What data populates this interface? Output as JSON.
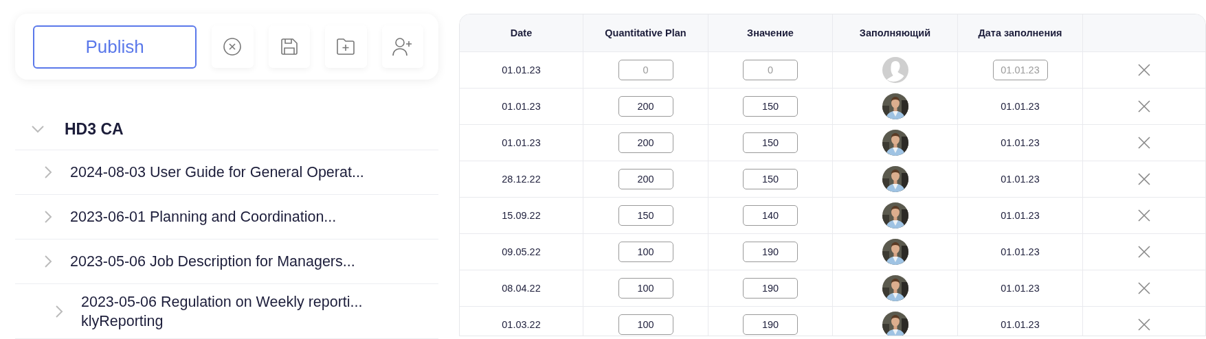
{
  "toolbar": {
    "publish": "Publish",
    "actions": [
      {
        "kind": "cancel"
      },
      {
        "kind": "save"
      },
      {
        "kind": "new-folder"
      },
      {
        "kind": "add-user"
      }
    ]
  },
  "tree": {
    "title": "HD3 CA",
    "expanded": true,
    "children": [
      {
        "label": "2024-08-03 User Guide for General Operat...",
        "expanded": false
      },
      {
        "label": "2023-06-01 Planning and Coordination...",
        "expanded": false
      },
      {
        "label": "2023-05-06 Job Description for Managers...",
        "expanded": false
      },
      {
        "label": "2023-05-06 Regulation on Weekly reporti...",
        "sublabel": "klyReporting",
        "expanded": false
      }
    ]
  },
  "table": {
    "columns": [
      "Date",
      "Quantitative Plan",
      "Значение",
      "Заполняющий",
      "Дата заполнения"
    ],
    "rows": [
      {
        "date": "01.01.23",
        "plan": {
          "placeholder": "0"
        },
        "value": {
          "placeholder": "0"
        },
        "filler": {
          "kind": "placeholder"
        },
        "filled_on": {
          "kind": "field",
          "placeholder": "01.01.23"
        }
      },
      {
        "date": "01.01.23",
        "plan": {
          "value": "200"
        },
        "value": {
          "value": "150"
        },
        "filled_on": {
          "kind": "text",
          "text": "01.01.23"
        }
      },
      {
        "date": "01.01.23",
        "plan": {
          "value": "200"
        },
        "value": {
          "value": "150"
        },
        "filled_on": {
          "kind": "text",
          "text": "01.01.23"
        }
      },
      {
        "date": "28.12.22",
        "plan": {
          "value": "200"
        },
        "value": {
          "value": "150"
        },
        "filled_on": {
          "kind": "text",
          "text": "01.01.23"
        }
      },
      {
        "date": "15.09.22",
        "plan": {
          "value": "150"
        },
        "value": {
          "value": "140"
        },
        "filled_on": {
          "kind": "text",
          "text": "01.01.23"
        }
      },
      {
        "date": "09.05.22",
        "plan": {
          "value": "100"
        },
        "value": {
          "value": "190"
        },
        "filled_on": {
          "kind": "text",
          "text": "01.01.23"
        }
      },
      {
        "date": "08.04.22",
        "plan": {
          "value": "100"
        },
        "value": {
          "value": "190"
        },
        "filled_on": {
          "kind": "text",
          "text": "01.01.23"
        }
      },
      {
        "date": "01.03.22",
        "plan": {
          "value": "100"
        },
        "value": {
          "value": "190"
        },
        "filled_on": {
          "kind": "text",
          "text": "01.01.23"
        }
      }
    ]
  }
}
